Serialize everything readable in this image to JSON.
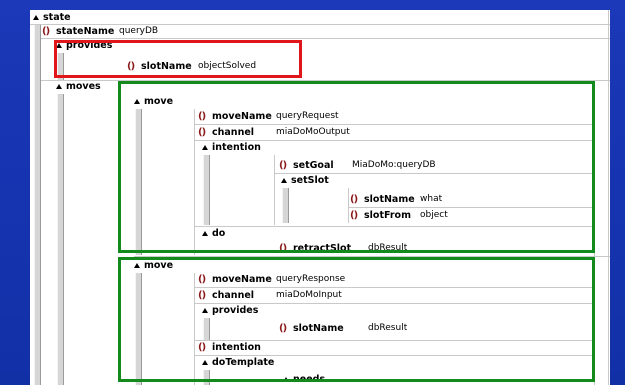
{
  "tree": {
    "state": "state",
    "stateName": {
      "label": "stateName",
      "value": "queryDB"
    },
    "provides": "provides",
    "slotName1": {
      "label": "slotName",
      "value": "objectSolved"
    },
    "moves": "moves",
    "move1": {
      "label": "move",
      "moveName": {
        "label": "moveName",
        "value": "queryRequest"
      },
      "channel": {
        "label": "channel",
        "value": "miaDoMoOutput"
      },
      "intention": "intention",
      "setGoal": {
        "label": "setGoal",
        "value": "MiaDoMo:queryDB"
      },
      "setSlot": "setSlot",
      "slotName": {
        "label": "slotName",
        "value": "what"
      },
      "slotFrom": {
        "label": "slotFrom",
        "value": "object"
      },
      "do": "do",
      "retractSlot": {
        "label": "retractSlot",
        "value": "dbResult"
      }
    },
    "move2": {
      "label": "move",
      "moveName": {
        "label": "moveName",
        "value": "queryResponse"
      },
      "channel": {
        "label": "channel",
        "value": "miaDoMoInput"
      },
      "provides": "provides",
      "slotName": {
        "label": "slotName",
        "value": "dbResult"
      },
      "intention": "intention",
      "doTemplate": "doTemplate",
      "needs": "needs"
    }
  },
  "icons": {
    "attribute": "attribute-icon",
    "collapse": "collapse-triangle-icon"
  },
  "colors": {
    "background": "#1634b0",
    "highlight_red": "#e0161a",
    "highlight_green": "#138a1c",
    "attr_icon": "#8b1a1a"
  }
}
